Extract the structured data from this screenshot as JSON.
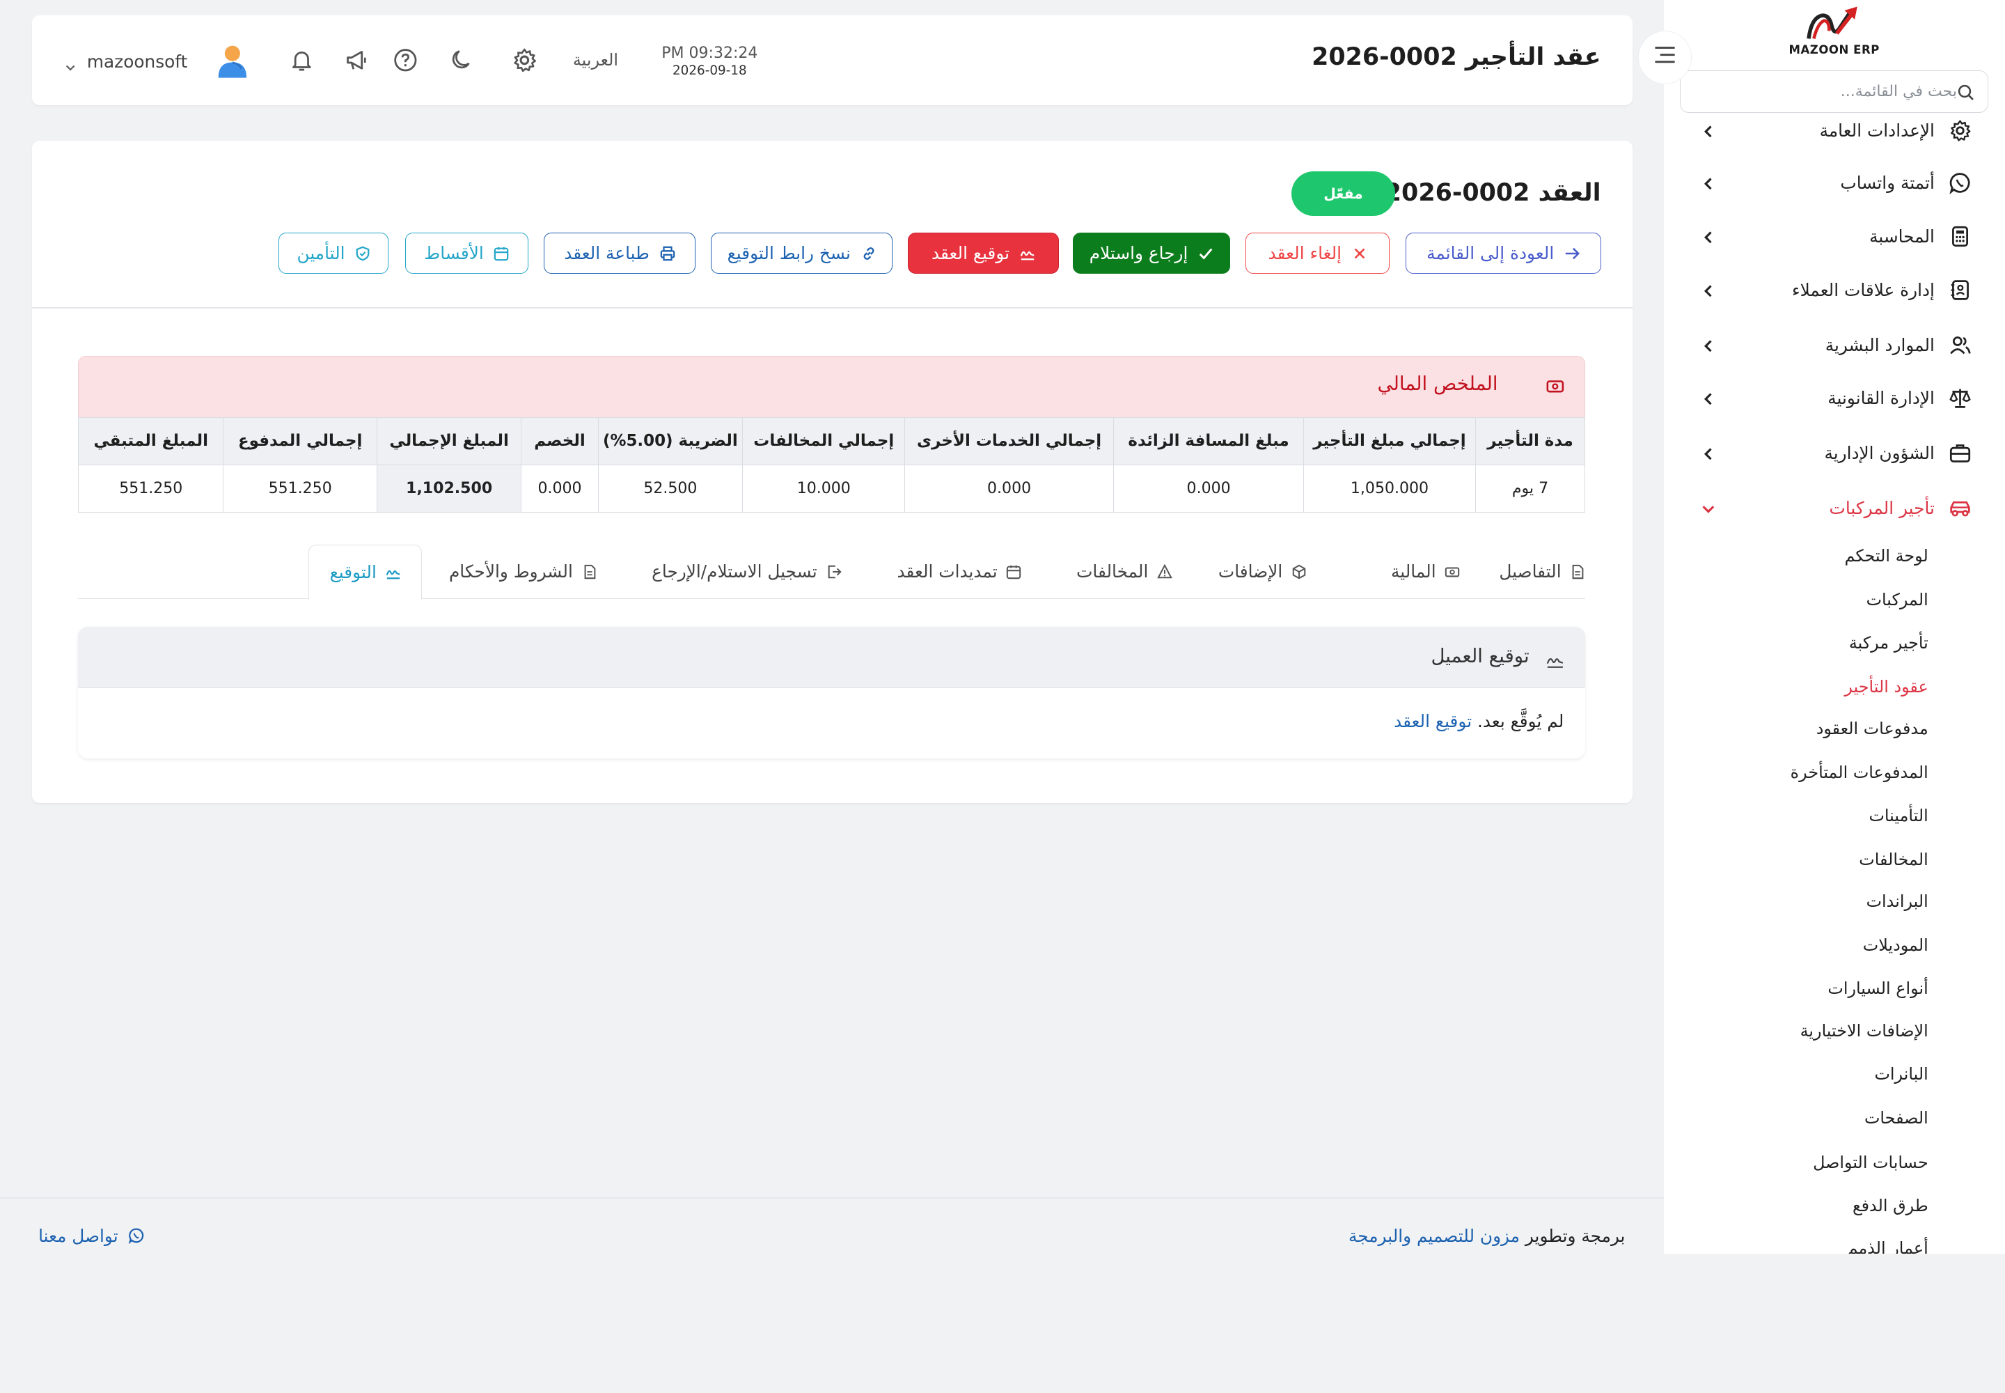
{
  "header": {
    "page_title": "عقد التأجير 0002-2026",
    "time": "PM 09:32:24",
    "date": "2026-09-18",
    "language": "العربية",
    "username": "mazoonsoft"
  },
  "sidebar": {
    "logo_text": "MAZOON ERP",
    "search_placeholder": "بحث في القائمة...",
    "items": [
      {
        "label": "الإعدادات العامة",
        "icon": "gear-icon"
      },
      {
        "label": "أتمتة واتساب",
        "icon": "whatsapp-icon"
      },
      {
        "label": "المحاسبة",
        "icon": "calculator-icon"
      },
      {
        "label": "إدارة علاقات العملاء",
        "icon": "contacts-icon"
      },
      {
        "label": "الموارد البشرية",
        "icon": "users-icon"
      },
      {
        "label": "الإدارة القانونية",
        "icon": "scales-icon"
      },
      {
        "label": "الشؤون الإدارية",
        "icon": "briefcase-icon"
      },
      {
        "label": "تأجير المركبات",
        "icon": "car-icon",
        "active": true
      }
    ],
    "subitems": [
      "لوحة التحكم",
      "المركبات",
      "تأجير مركبة",
      "عقود التأجير",
      "مدفوعات العقود",
      "المدفوعات المتأخرة",
      "التأمينات",
      "المخالفات",
      "البراندات",
      "الموديلات",
      "أنواع السيارات",
      "الإضافات الاختيارية",
      "البانرات",
      "الصفحات",
      "حسابات التواصل",
      "طرق الدفع",
      "أعمار الذمم"
    ],
    "active_subitem": "عقود التأجير"
  },
  "contract": {
    "title": "العقد 0002-2026",
    "status": "مفعّل",
    "actions": {
      "back": "العودة إلى القائمة",
      "cancel": "إلغاء العقد",
      "return": "إرجاع واستلام",
      "sign": "توقيع العقد",
      "copy_link": "نسخ رابط التوقيع",
      "print": "طباعة العقد",
      "installments": "الأقساط",
      "insurance": "التأمين"
    }
  },
  "financial_summary": {
    "title": "الملخص المالي",
    "headers": [
      "مدة التأجير",
      "إجمالي مبلغ التأجير",
      "مبلغ المسافة الزائدة",
      "إجمالي الخدمات الأخرى",
      "إجمالي المخالفات",
      "الضريبة (5.00%)",
      "الخصم",
      "المبلغ الإجمالي",
      "إجمالي المدفوع",
      "المبلغ المتبقي"
    ],
    "values": [
      "7 يوم",
      "1,050.000",
      "0.000",
      "0.000",
      "10.000",
      "52.500",
      "0.000",
      "1,102.500",
      "551.250",
      "551.250"
    ]
  },
  "tabs": [
    {
      "label": "التفاصيل",
      "icon": "document-icon"
    },
    {
      "label": "المالية",
      "icon": "money-icon"
    },
    {
      "label": "الإضافات",
      "icon": "box-icon"
    },
    {
      "label": "المخالفات",
      "icon": "warning-icon"
    },
    {
      "label": "تمديدات العقد",
      "icon": "calendar-icon"
    },
    {
      "label": "تسجيل الاستلام/الإرجاع",
      "icon": "exit-icon"
    },
    {
      "label": "الشروط والأحكام",
      "icon": "document-icon"
    },
    {
      "label": "التوقيع",
      "icon": "signature-icon",
      "active": true
    }
  ],
  "signature": {
    "title": "توقيع العميل",
    "not_signed": "لم يُوقَّع بعد.",
    "sign_link": "توقيع العقد"
  },
  "footer": {
    "contact": "تواصل معنا",
    "credit_prefix": "برمجة وتطوير",
    "credit_link": "مزون للتصميم والبرمجة"
  },
  "colors": {
    "accent_red": "#dc3545",
    "status_green": "#1ec76e",
    "link_blue": "#1c62b0"
  }
}
